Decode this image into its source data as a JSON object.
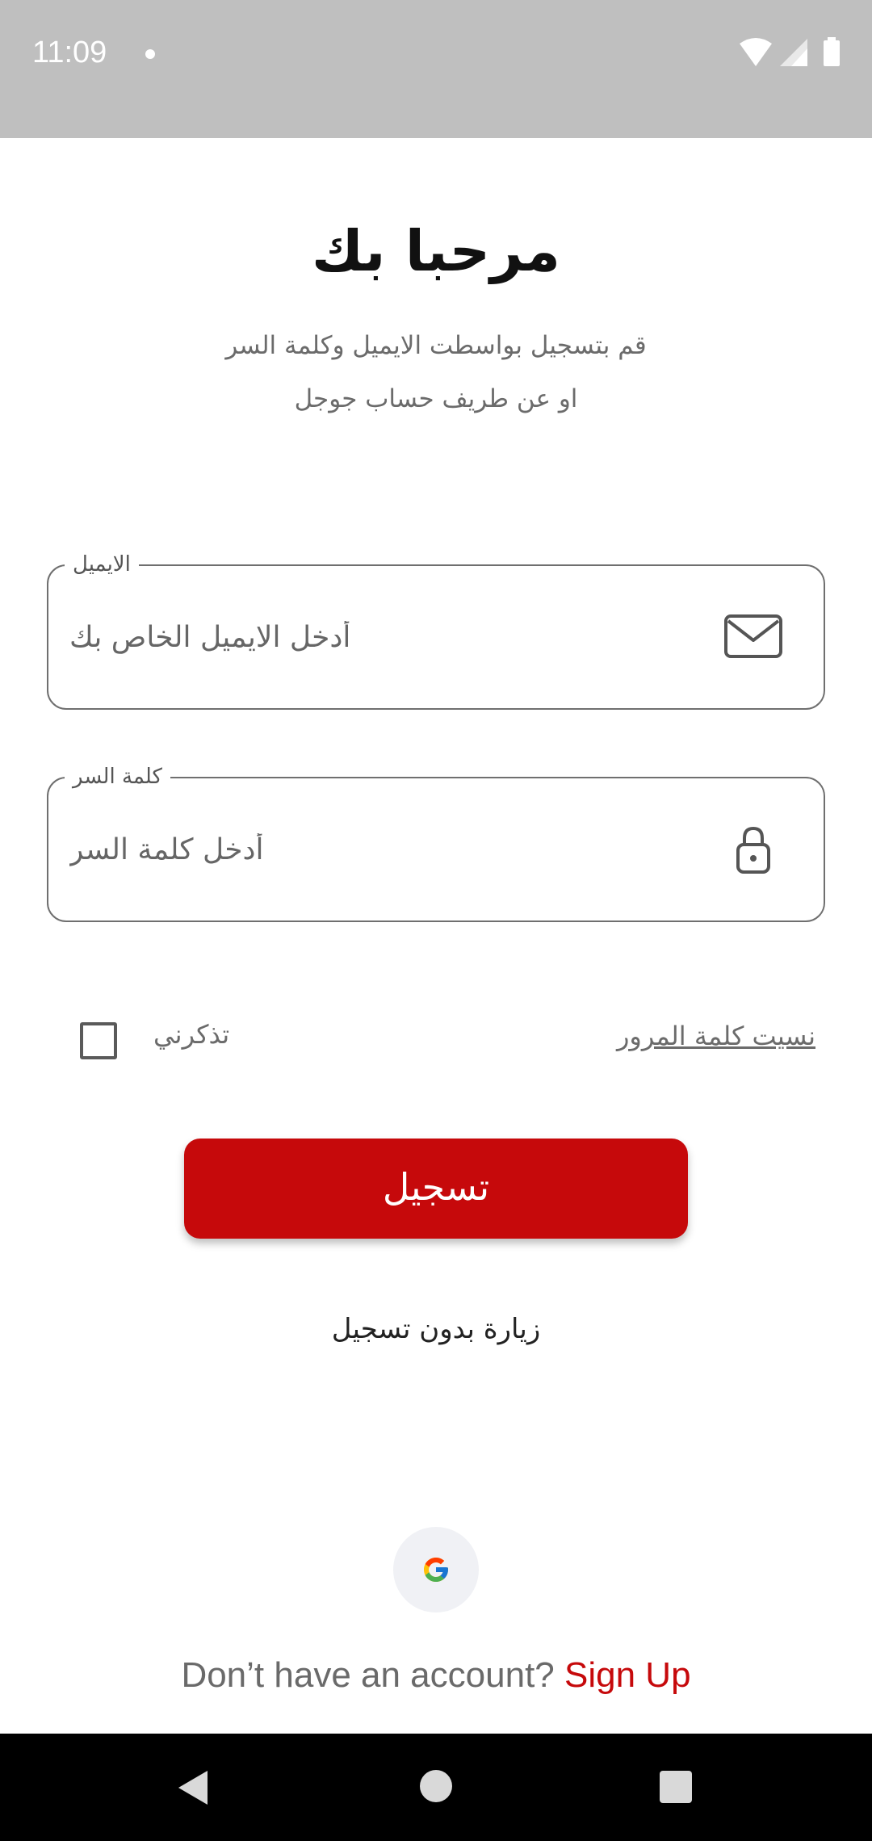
{
  "status_bar": {
    "time": "11:09",
    "icons": [
      "wifi-icon",
      "signal-icon",
      "battery-icon"
    ]
  },
  "header": {
    "title": "مرحبا بك",
    "subtitle_line1": "قم بتسجيل بواسطت الايميل وكلمة السر",
    "subtitle_line2": "او عن طريف حساب جوجل"
  },
  "form": {
    "email": {
      "label": "الايميل",
      "placeholder": "أدخل الايميل الخاص بك",
      "value": "",
      "icon": "mail-icon"
    },
    "password": {
      "label": "كلمة السر",
      "placeholder": "أدخل كلمة السر",
      "value": "",
      "icon": "lock-icon"
    },
    "remember_me_label": "تذكرني",
    "remember_me_checked": false,
    "forgot_password_label": "نسيت كلمة المرور",
    "login_button_label": "تسجيل",
    "guest_label": "زيارة بدون تسجيل"
  },
  "footer": {
    "google_icon": "google-icon",
    "signup_prompt": "Don’t have an account?",
    "signup_link": "Sign Up"
  },
  "colors": {
    "accent": "#c6090b",
    "status_bar": "#bfbfbf",
    "nav_bar": "#000000",
    "google_bg": "#f0f1f5"
  }
}
